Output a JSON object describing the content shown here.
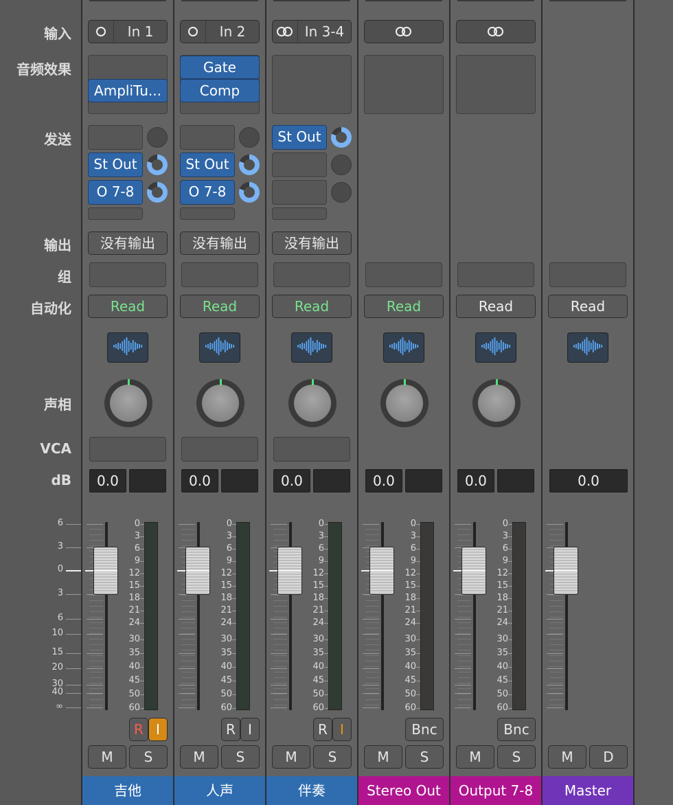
{
  "row_labels": {
    "input": "输入",
    "audio_fx": "音频效果",
    "sends": "发送",
    "output": "输出",
    "group": "组",
    "automation": "自动化",
    "pan": "声相",
    "vca": "VCA",
    "db": "dB"
  },
  "left_scale": [
    "6",
    "3",
    "0",
    "3",
    "6",
    "10",
    "15",
    "20",
    "30",
    "40",
    "∞"
  ],
  "meter_scale": [
    "0",
    "3",
    "6",
    "9",
    "12",
    "15",
    "18",
    "21",
    "24",
    "30",
    "35",
    "40",
    "45",
    "50",
    "60"
  ],
  "icons": {
    "mono_input": "ring-icon",
    "stereo_input": "stereo-link-icon",
    "eq": "eq-waveform-icon"
  },
  "colors": {
    "audio_track_name": "#2f6db0",
    "output_track_name": "#b0158f",
    "master_track_name": "#7034b8",
    "read_active": "#79e38f",
    "plugin_blue": "#2f66a8"
  },
  "strips": [
    {
      "name": "吉他",
      "input": "In 1",
      "plugins": [
        "AmpliTu..."
      ],
      "sends": [
        "St Out",
        "O 7-8"
      ],
      "output": "没有输出",
      "automation": "Read",
      "db_left": "0.0",
      "rec": "R",
      "input_mon": "I",
      "mute": "M",
      "solo": "S"
    },
    {
      "name": "人声",
      "input": "In 2",
      "plugins": [
        "Gate",
        "Comp"
      ],
      "sends": [
        "St Out",
        "O 7-8"
      ],
      "output": "没有输出",
      "automation": "Read",
      "db_left": "0.0",
      "rec": "R",
      "input_mon": "I",
      "mute": "M",
      "solo": "S"
    },
    {
      "name": "伴奏",
      "input": "In 3-4",
      "plugins": [],
      "sends": [
        "St Out"
      ],
      "output": "没有输出",
      "automation": "Read",
      "db_left": "0.0",
      "rec": "R",
      "input_mon": "I",
      "mute": "M",
      "solo": "S"
    },
    {
      "name": "Stereo Out",
      "automation": "Read",
      "db_left": "0.0",
      "bnc": "Bnc",
      "mute": "M",
      "solo": "S"
    },
    {
      "name": "Output 7-8",
      "automation": "Read",
      "db_left": "0.0",
      "bnc": "Bnc",
      "mute": "M",
      "solo": "S"
    },
    {
      "name": "Master",
      "automation": "Read",
      "db_left": "0.0",
      "mute": "M",
      "dim": "D"
    }
  ]
}
